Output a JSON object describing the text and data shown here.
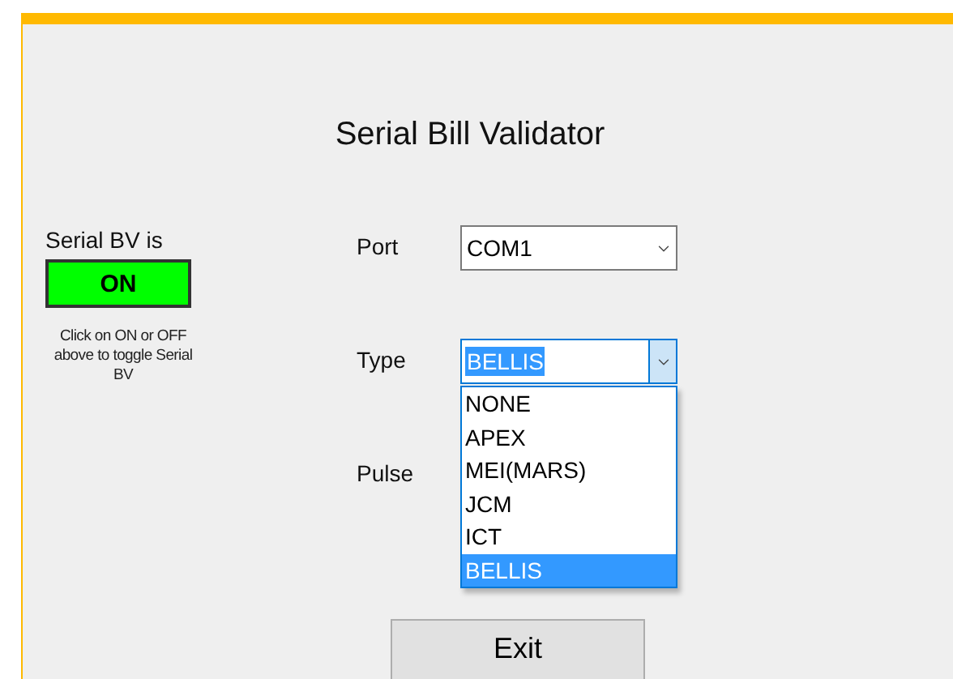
{
  "window": {
    "title": "Serial Bill Validator"
  },
  "serial_bv": {
    "label": "Serial BV is",
    "toggle": {
      "text": "ON",
      "on": true
    },
    "hint": "Click on ON or OFF above to toggle Serial BV"
  },
  "fields": [
    {
      "label": "Port",
      "kind": "combo",
      "value": "COM1",
      "focused": false
    },
    {
      "label": "Type",
      "kind": "combo",
      "value": "BELLIS",
      "focused": true,
      "options": [
        {
          "text": "NONE",
          "selected": false
        },
        {
          "text": "APEX",
          "selected": false
        },
        {
          "text": "MEI(MARS)",
          "selected": false
        },
        {
          "text": "JCM",
          "selected": false
        },
        {
          "text": "ICT",
          "selected": false
        },
        {
          "text": "BELLIS",
          "selected": true
        }
      ]
    },
    {
      "label": "Pulse",
      "kind": "hidden"
    }
  ],
  "buttons": [
    {
      "label": "Exit"
    }
  ]
}
